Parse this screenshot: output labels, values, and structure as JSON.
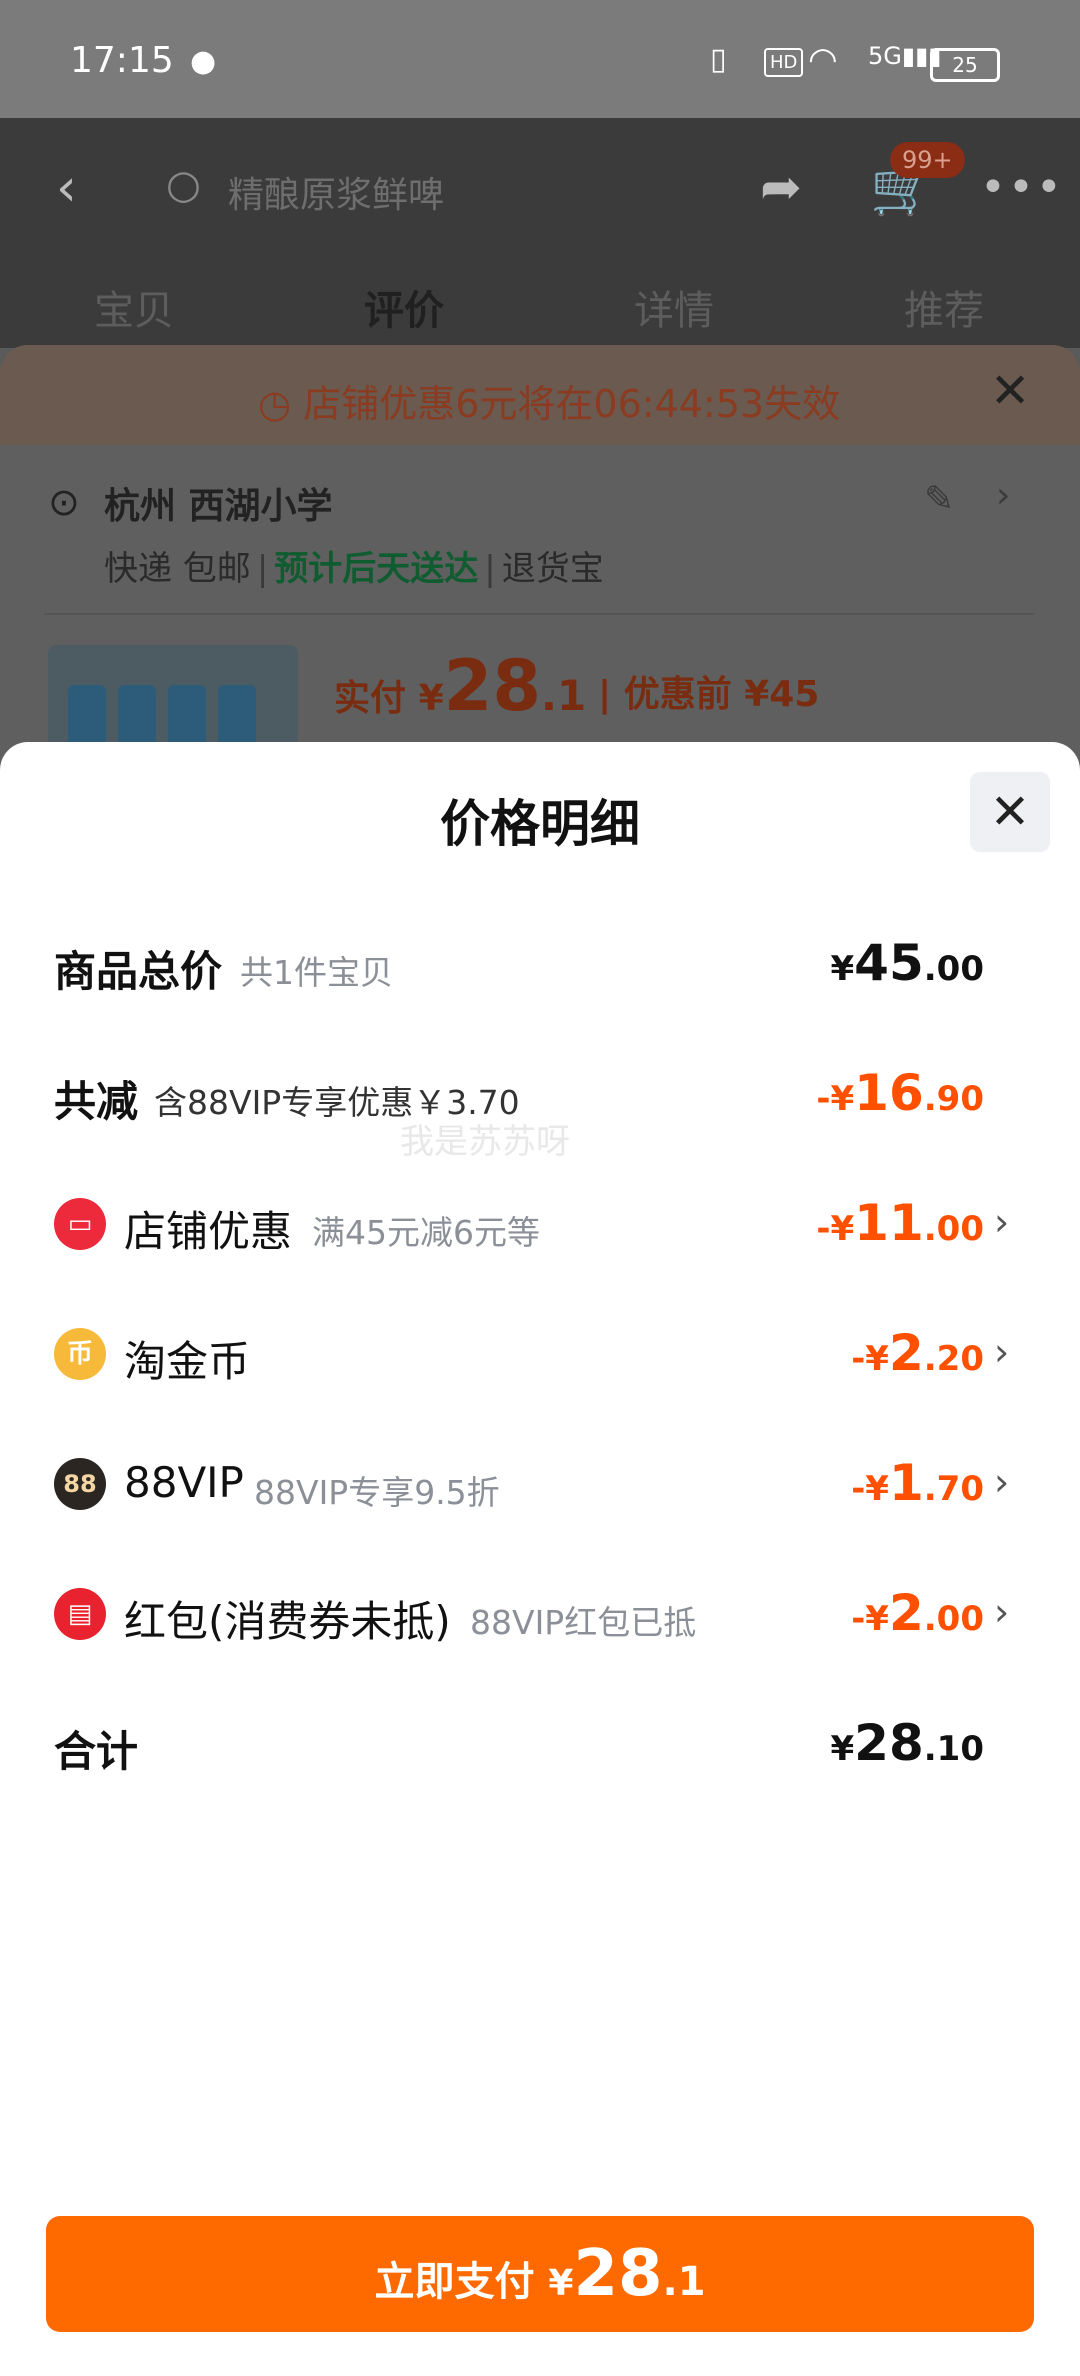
{
  "status_bar": {
    "time": "17:15",
    "network": "5G",
    "hd": "HD",
    "battery": "25"
  },
  "header": {
    "search_placeholder": "精酿原浆鲜啤",
    "cart_badge": "99+",
    "tabs": [
      "宝贝",
      "评价",
      "详情",
      "推荐"
    ],
    "active_tab": "评价"
  },
  "order_card": {
    "coupon_notice": "店铺优惠6元将在06:44:53失效",
    "address": "杭州 西湖小学",
    "ship_method": "快递 包邮",
    "delivery": "预计后天送达",
    "return_service": "退货宝",
    "paid_label": "实付",
    "paid_currency": "¥",
    "paid_int": "28",
    "paid_dec": ".1",
    "pre_discount": "优惠前 ¥45"
  },
  "sheet": {
    "title": "价格明细",
    "rows": [
      {
        "label": "商品总价",
        "sub": "共1件宝贝",
        "currency": "¥",
        "int": "45",
        "dec": ".00"
      },
      {
        "label": "共减",
        "sub": "含88VIP专享优惠￥3.70",
        "currency": "-¥",
        "int": "16",
        "dec": ".90"
      },
      {
        "label": "店铺优惠",
        "sub": "满45元减6元等",
        "currency": "-¥",
        "int": "11",
        "dec": ".00",
        "icon": "shop-icon"
      },
      {
        "label": "淘金币",
        "sub": "",
        "currency": "-¥",
        "int": "2",
        "dec": ".20",
        "icon": "coin-icon",
        "icon_glyph": "币"
      },
      {
        "label": "88VIP",
        "sub": "88VIP专享9.5折",
        "currency": "-¥",
        "int": "1",
        "dec": ".70",
        "icon": "vip-icon",
        "icon_glyph": "88"
      },
      {
        "label": "红包(消费券未抵)",
        "sub": "88VIP红包已抵",
        "currency": "-¥",
        "int": "2",
        "dec": ".00",
        "icon": "red-packet-icon"
      },
      {
        "label": "合计",
        "sub": "",
        "currency": "¥",
        "int": "28",
        "dec": ".10"
      }
    ],
    "watermark": "我是苏苏呀",
    "pay_button": {
      "label": "立即支付",
      "currency": "¥",
      "int": "28",
      "dec": ".1"
    }
  },
  "colors": {
    "accent": "#ff5000",
    "pay_button": "#ff6a00",
    "sheet_bg": "#ffffff"
  }
}
